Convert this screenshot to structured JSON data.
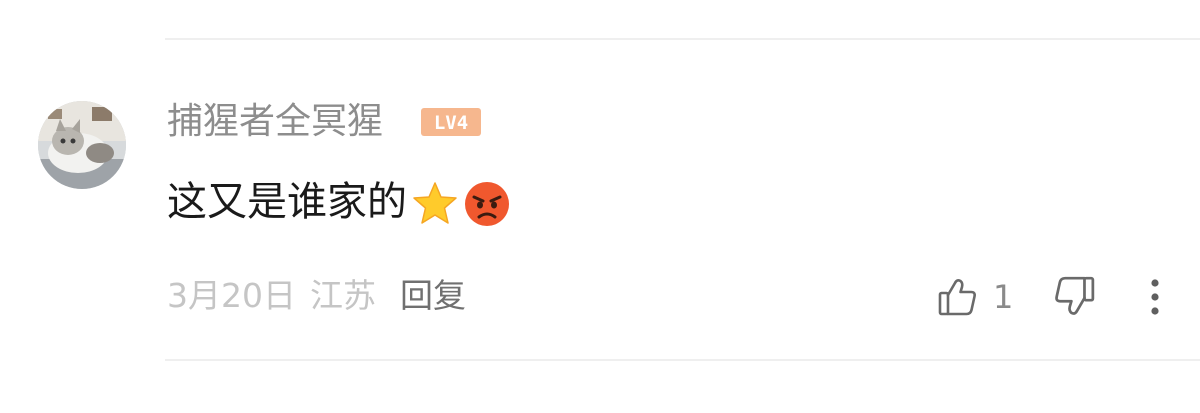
{
  "comment": {
    "username": "捕猩者全冥猩",
    "level": "LV4",
    "text": "这又是谁家的",
    "emojis": [
      "star-emoji",
      "angry-face-emoji"
    ],
    "date": "3月20日",
    "location": "江苏",
    "reply_label": "回复",
    "like_count": "1"
  },
  "colors": {
    "level_badge": "#f6b78e",
    "username": "#8d8d8d",
    "meta": "#c5c5c5",
    "reply": "#707070",
    "icon": "#6a6a6a"
  }
}
